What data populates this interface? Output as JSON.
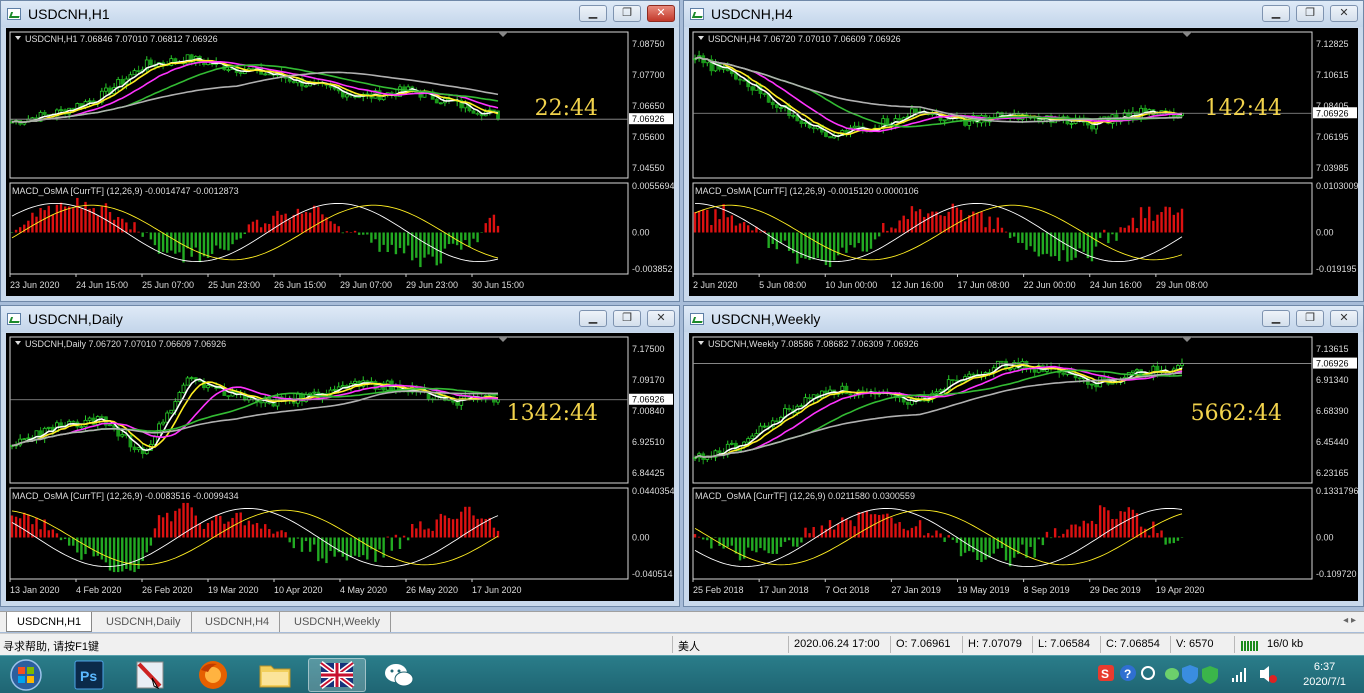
{
  "windows": [
    {
      "id": "h1",
      "title": "USDCNH,H1",
      "symbol_line": "USDCNH,H1  7.06846 7.07010 7.06812 7.06926",
      "countdown": "22:44",
      "prices": [
        "7.08750",
        "7.07700",
        "7.06650",
        "7.05600",
        "7.04550"
      ],
      "price_current": "7.06926",
      "macd_label": "MACD_OsMA [CurrTF] (12,26,9) -0.0014747 -0.0012873",
      "macd_scale": [
        "0.0055694",
        "0.00",
        "-0.003852"
      ],
      "dates": [
        "23 Jun 2020",
        "24 Jun 15:00",
        "25 Jun 07:00",
        "25 Jun 23:00",
        "26 Jun 15:00",
        "29 Jun 07:00",
        "29 Jun 23:00",
        "30 Jun 15:00"
      ]
    },
    {
      "id": "h4",
      "title": "USDCNH,H4",
      "symbol_line": "USDCNH,H4  7.06720 7.07010 7.06609 7.06926",
      "countdown": "142:44",
      "prices": [
        "7.12825",
        "7.10615",
        "7.08405",
        "7.06195",
        "7.03985"
      ],
      "price_current": "7.06926",
      "macd_label": "MACD_OsMA [CurrTF] (12,26,9) -0.0015120 0.0000106",
      "macd_scale": [
        "0.0103009",
        "0.00",
        "-0.019195"
      ],
      "dates": [
        "2 Jun 2020",
        "5 Jun 08:00",
        "10 Jun 00:00",
        "12 Jun 16:00",
        "17 Jun 08:00",
        "22 Jun 00:00",
        "24 Jun 16:00",
        "29 Jun 08:00"
      ]
    },
    {
      "id": "daily",
      "title": "USDCNH,Daily",
      "symbol_line": "USDCNH,Daily  7.06720 7.07010 7.06609 7.06926",
      "countdown": "1342:44",
      "prices": [
        "7.17500",
        "7.09170",
        "7.00840",
        "6.92510",
        "6.84425"
      ],
      "price_current": "7.06926",
      "macd_label": "MACD_OsMA [CurrTF] (12,26,9) -0.0083516 -0.0099434",
      "macd_scale": [
        "0.0440354",
        "0.00",
        "-0.040514"
      ],
      "dates": [
        "13 Jan 2020",
        "4 Feb 2020",
        "26 Feb 2020",
        "19 Mar 2020",
        "10 Apr 2020",
        "4 May 2020",
        "26 May 2020",
        "17 Jun 2020"
      ]
    },
    {
      "id": "weekly",
      "title": "USDCNH,Weekly",
      "symbol_line": "USDCNH,Weekly  7.08586 7.08682 7.06309 7.06926",
      "countdown": "5662:44",
      "prices": [
        "7.13615",
        "6.91340",
        "6.68390",
        "6.45440",
        "6.23165"
      ],
      "price_current": "7.06926",
      "macd_label": "MACD_OsMA [CurrTF] (12,26,9) 0.0211580 0.0300559",
      "macd_scale": [
        "0.1331796",
        "0.00",
        "-0.109720"
      ],
      "dates": [
        "25 Feb 2018",
        "17 Jun 2018",
        "7 Oct 2018",
        "27 Jan 2019",
        "19 May 2019",
        "8 Sep 2019",
        "29 Dec 2019",
        "19 Apr 2020"
      ]
    }
  ],
  "tabs": [
    "USDCNH,H1",
    "USDCNH,Daily",
    "USDCNH,H4",
    "USDCNH,Weekly"
  ],
  "tab_arrows": "◂ ▸",
  "status": {
    "help": "寻求帮助, 请按F1键",
    "profile": "美人",
    "datetime": "2020.06.24 17:00",
    "open": "O: 7.06961",
    "high": "H: 7.07079",
    "low": "L: 7.06584",
    "close": "C: 7.06854",
    "volume": "V: 6570",
    "traffic": "16/0 kb"
  },
  "taskbar": {
    "items": [
      "start-orb",
      "photoshop",
      "paint-tool",
      "firefox",
      "file-explorer",
      "metatrader",
      "wechat"
    ],
    "time": "6:37",
    "date": "2020/7/1"
  },
  "colors": {
    "bull": "#29cc29",
    "bear": "#1a9a1a",
    "ma_fast": "#ffffff",
    "ma_yellow": "#ffee22",
    "ma_magenta": "#ff33ff",
    "ma_green": "#33bb33",
    "ma_gray": "#b0b0b0",
    "osma_pos": "#dd1111",
    "osma_neg": "#22aa22",
    "countdown": "#f2d34c"
  }
}
